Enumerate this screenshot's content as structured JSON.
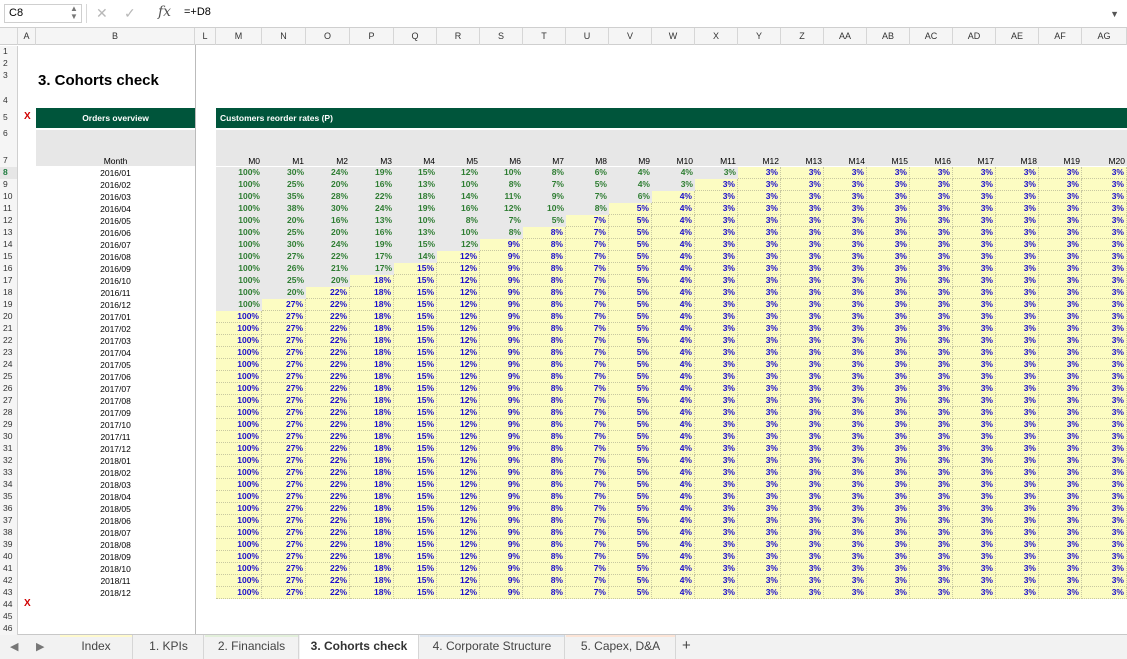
{
  "formula_bar": {
    "cell_ref": "C8",
    "formula": "=+D8",
    "fx": "fx"
  },
  "columns": [
    "A",
    "B",
    "L",
    "M",
    "N",
    "O",
    "P",
    "Q",
    "R",
    "S",
    "T",
    "U",
    "V",
    "W",
    "X",
    "Y",
    "Z",
    "AA",
    "AB",
    "AC",
    "AD",
    "AE",
    "AF",
    "AG"
  ],
  "title": "3. Cohorts check",
  "x_mark": "X",
  "orders_overview": "Orders overview",
  "reorder_title": "Customers reorder rates (P)",
  "month_header": "Month",
  "month_cols": [
    "M0",
    "M1",
    "M2",
    "M3",
    "M4",
    "M5",
    "M6",
    "M7",
    "M8",
    "M9",
    "M10",
    "M11",
    "M12",
    "M13",
    "M14",
    "M15",
    "M16",
    "M17",
    "M18",
    "M19",
    "M20"
  ],
  "months": [
    "2016/01",
    "2016/02",
    "2016/03",
    "2016/04",
    "2016/05",
    "2016/06",
    "2016/07",
    "2016/08",
    "2016/09",
    "2016/10",
    "2016/11",
    "2016/12",
    "2017/01",
    "2017/02",
    "2017/03",
    "2017/04",
    "2017/05",
    "2017/06",
    "2017/07",
    "2017/08",
    "2017/09",
    "2017/10",
    "2017/11",
    "2017/12",
    "2018/01",
    "2018/02",
    "2018/03",
    "2018/04",
    "2018/05",
    "2018/06",
    "2018/07",
    "2018/08",
    "2018/09",
    "2018/10",
    "2018/11",
    "2018/12"
  ],
  "actual_rows": [
    [
      "100%",
      "30%",
      "24%",
      "19%",
      "15%",
      "12%",
      "10%",
      "8%",
      "6%",
      "4%",
      "4%",
      "3%"
    ],
    [
      "100%",
      "25%",
      "20%",
      "16%",
      "13%",
      "10%",
      "8%",
      "7%",
      "5%",
      "4%",
      "3%"
    ],
    [
      "100%",
      "35%",
      "28%",
      "22%",
      "18%",
      "14%",
      "11%",
      "9%",
      "7%",
      "6%"
    ],
    [
      "100%",
      "38%",
      "30%",
      "24%",
      "19%",
      "16%",
      "12%",
      "10%",
      "8%"
    ],
    [
      "100%",
      "20%",
      "16%",
      "13%",
      "10%",
      "8%",
      "7%",
      "5%"
    ],
    [
      "100%",
      "25%",
      "20%",
      "16%",
      "13%",
      "10%",
      "8%"
    ],
    [
      "100%",
      "30%",
      "24%",
      "19%",
      "15%",
      "12%"
    ],
    [
      "100%",
      "27%",
      "22%",
      "17%",
      "14%"
    ],
    [
      "100%",
      "26%",
      "21%",
      "17%"
    ],
    [
      "100%",
      "25%",
      "20%"
    ],
    [
      "100%",
      "20%"
    ],
    [
      "100%"
    ]
  ],
  "projected": [
    "100%",
    "27%",
    "22%",
    "18%",
    "15%",
    "12%",
    "9%",
    "8%",
    "7%",
    "5%",
    "4%",
    "3%",
    "3%",
    "3%",
    "3%",
    "3%",
    "3%",
    "3%",
    "3%",
    "3%",
    "3%"
  ],
  "tabs": [
    {
      "label": "Index",
      "color": "#fffacd"
    },
    {
      "label": "1. KPIs",
      "color": "#f2f2f2"
    },
    {
      "label": "2. Financials",
      "color": "#e2efda"
    },
    {
      "label": "3. Cohorts check",
      "color": "#ffffff"
    },
    {
      "label": "4. Corporate Structure",
      "color": "#dae4f0"
    },
    {
      "label": "5. Capex, D&A",
      "color": "#fce4d6"
    }
  ],
  "add_tab": "+",
  "active_tab": "3. Cohorts check",
  "active_row": "8"
}
